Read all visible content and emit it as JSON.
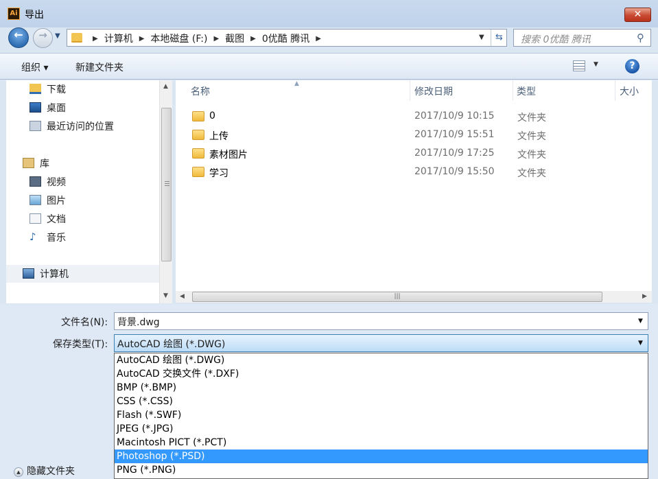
{
  "window": {
    "title": "导出",
    "app_icon": "Ai",
    "close_glyph": "✕"
  },
  "nav_buttons": {
    "back_glyph": "←",
    "forward_glyph": "→"
  },
  "address": {
    "crumbs": [
      "计算机",
      "本地磁盘 (F:)",
      "截图",
      "0优酷 腾讯"
    ],
    "separator": "▶"
  },
  "search": {
    "placeholder": "搜索 0优酷 腾讯"
  },
  "toolbar": {
    "organize_label": "组织 ▾",
    "new_folder_label": "新建文件夹",
    "help_glyph": "?"
  },
  "nav_pane": {
    "items": [
      {
        "label": "下载",
        "icon": "downloads-icon"
      },
      {
        "label": "桌面",
        "icon": "desktop-icon"
      },
      {
        "label": "最近访问的位置",
        "icon": "recent-places-icon"
      },
      {
        "label": "库",
        "icon": "library-icon"
      },
      {
        "label": "视频",
        "icon": "videos-icon"
      },
      {
        "label": "图片",
        "icon": "pictures-icon"
      },
      {
        "label": "文档",
        "icon": "documents-icon"
      },
      {
        "label": "音乐",
        "icon": "music-icon"
      },
      {
        "label": "计算机",
        "icon": "computer-icon"
      }
    ]
  },
  "file_list": {
    "columns": [
      "名称",
      "修改日期",
      "类型",
      "大小"
    ],
    "rows": [
      {
        "name": "0",
        "date": "2017/10/9 10:15",
        "type": "文件夹"
      },
      {
        "name": "上传",
        "date": "2017/10/9 15:51",
        "type": "文件夹"
      },
      {
        "name": "素材图片",
        "date": "2017/10/9 17:25",
        "type": "文件夹"
      },
      {
        "name": "学习",
        "date": "2017/10/9 15:50",
        "type": "文件夹"
      }
    ]
  },
  "form": {
    "filename_label": "文件名(N):",
    "filename_value": "背景.dwg",
    "filetype_label": "保存类型(T):",
    "filetype_value": "AutoCAD 绘图 (*.DWG)"
  },
  "filetype_options": [
    "AutoCAD 绘图 (*.DWG)",
    "AutoCAD 交换文件 (*.DXF)",
    "BMP (*.BMP)",
    "CSS (*.CSS)",
    "Flash (*.SWF)",
    "JPEG (*.JPG)",
    "Macintosh PICT (*.PCT)",
    "Photoshop (*.PSD)",
    "PNG (*.PNG)"
  ],
  "highlighted_option": "Photoshop (*.PSD)",
  "hide_folders_label": "隐藏文件夹",
  "colors": {
    "selection": "#3399ff",
    "window_chrome": "#dbe6f3"
  }
}
